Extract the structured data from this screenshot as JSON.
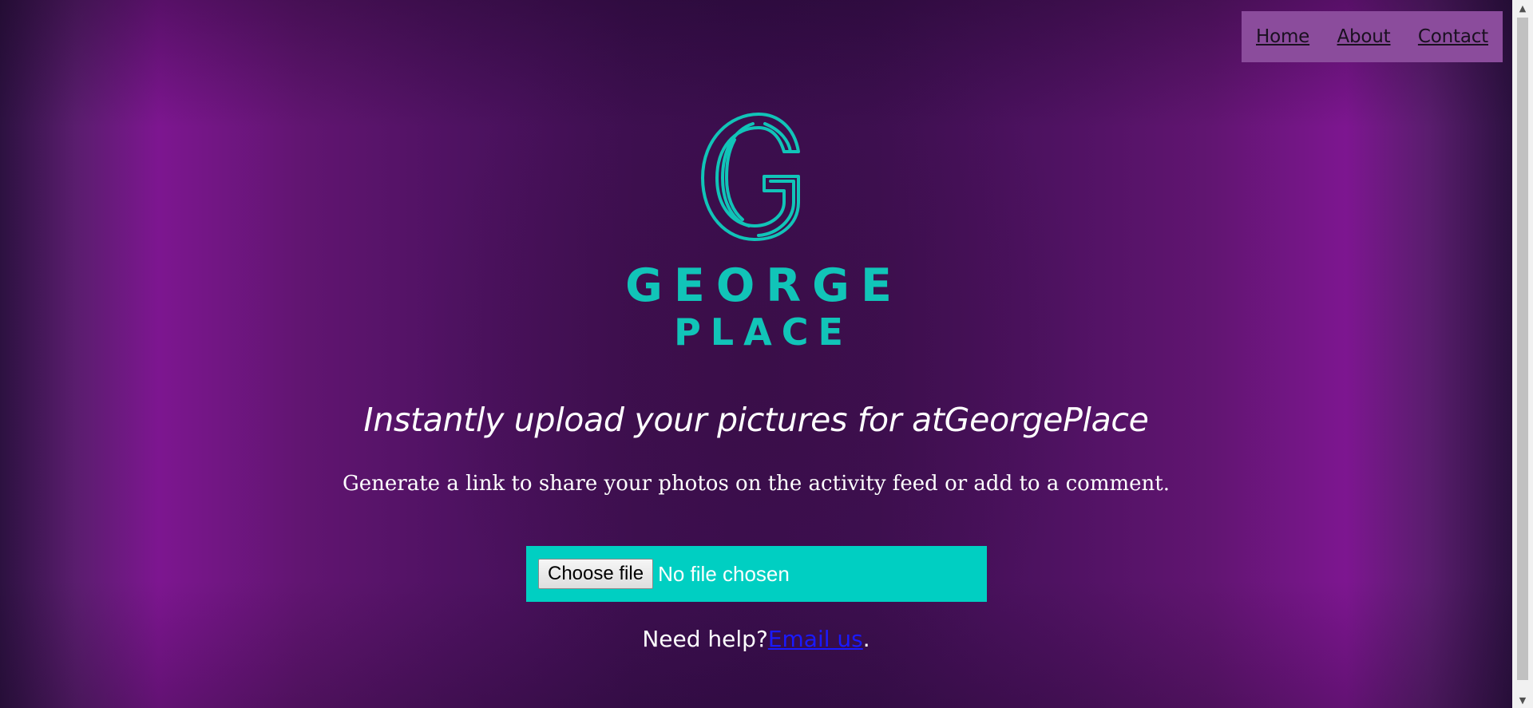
{
  "nav": {
    "items": [
      {
        "label": "Home"
      },
      {
        "label": "About"
      },
      {
        "label": "Contact"
      }
    ]
  },
  "logo": {
    "line1": "GEORGE",
    "line2": "PLACE",
    "color": "#11c4b8"
  },
  "hero": {
    "headline": "Instantly upload your pictures for atGeorgePlace",
    "subline": "Generate a link to share your photos on the activity feed or add to a comment."
  },
  "upload": {
    "button_label": "Choose file",
    "status": "No file chosen",
    "background_color": "#00cfc2"
  },
  "help": {
    "prefix": "Need help?",
    "link_label": "Email us",
    "suffix": "."
  },
  "theme": {
    "purple": "#7d1690",
    "dark_purple": "#3b0e50"
  }
}
